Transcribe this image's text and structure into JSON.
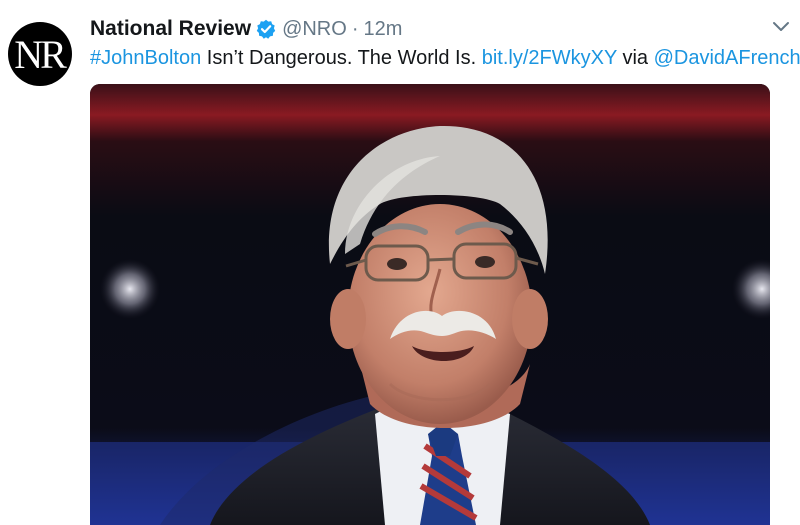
{
  "tweet": {
    "account": {
      "display_name": "National Review",
      "handle": "@NRO",
      "verified": true,
      "avatar_text": "NR"
    },
    "time_separator": "·",
    "time": "12m",
    "text": {
      "hashtag": "#JohnBolton",
      "body": " Isn’t Dangerous. The World Is. ",
      "link": "bit.ly/2FWkyXY",
      "via": " via ",
      "mention": "@DavidAFrench"
    },
    "media": {
      "kind": "photo"
    }
  },
  "icons": {
    "verified": "verified-badge-icon",
    "menu": "chevron-down-icon"
  },
  "colors": {
    "link": "#1b95e0",
    "name": "#14171a",
    "muted": "#657786",
    "verified": "#1da1f2"
  }
}
